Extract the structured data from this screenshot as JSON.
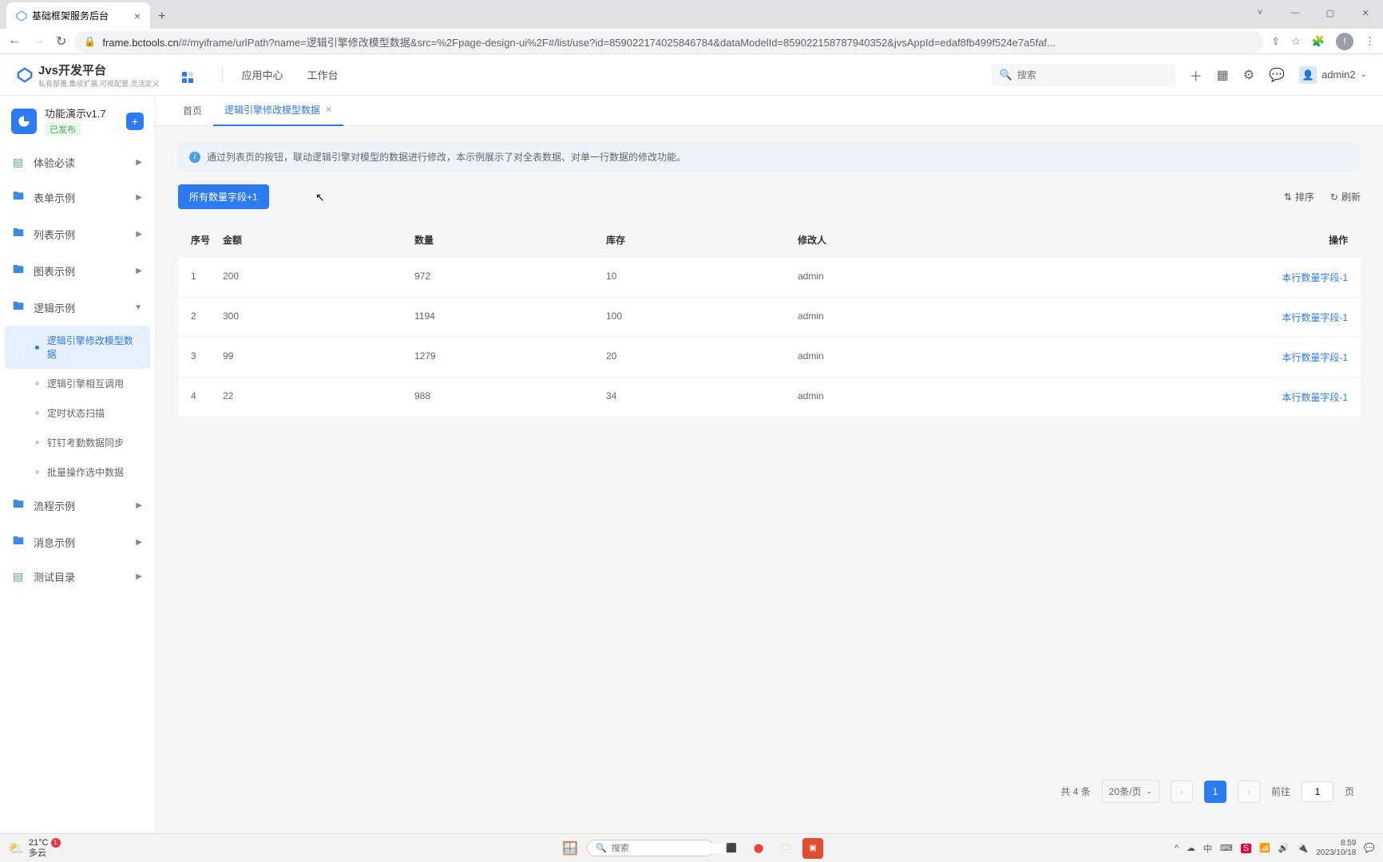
{
  "browser": {
    "tab_title": "基础框架服务后台",
    "url_prefix": "frame.bctools.cn",
    "url_rest": "/#/myiframe/urlPath?name=逻辑引擎修改模型数据&src=%2Fpage-design-ui%2F#/list/use?id=859022174025846784&dataModelId=859022158787940352&jvsAppId=edaf8fb499f524e7a5faf..."
  },
  "header": {
    "logo_title": "Jvs开发平台",
    "logo_sub": "私有部署.集成扩展.可视配置.灵活定义",
    "nav": [
      "应用中心",
      "工作台"
    ],
    "search_placeholder": "搜索",
    "user": "admin2"
  },
  "sidebar": {
    "project": {
      "title": "功能演示v1.7",
      "badge": "已发布"
    },
    "items": [
      {
        "icon": "doc",
        "label": "体验必读",
        "arrow": "right"
      },
      {
        "icon": "folder",
        "label": "表单示例",
        "arrow": "right"
      },
      {
        "icon": "folder",
        "label": "列表示例",
        "arrow": "right"
      },
      {
        "icon": "folder",
        "label": "图表示例",
        "arrow": "right"
      },
      {
        "icon": "folder",
        "label": "逻辑示例",
        "arrow": "down"
      },
      {
        "icon": "folder",
        "label": "流程示例",
        "arrow": "right"
      },
      {
        "icon": "folder",
        "label": "消息示例",
        "arrow": "right"
      },
      {
        "icon": "doc",
        "label": "测试目录",
        "arrow": "right"
      }
    ],
    "logic_sub": [
      {
        "label": "逻辑引擎修改模型数据",
        "active": true
      },
      {
        "label": "逻辑引擎相互调用",
        "active": false
      },
      {
        "label": "定时状态扫描",
        "active": false
      },
      {
        "label": "钉钉考勤数据同步",
        "active": false
      },
      {
        "label": "批量操作选中数据",
        "active": false
      }
    ]
  },
  "main_tabs": [
    {
      "label": "首页",
      "closable": false,
      "active": false
    },
    {
      "label": "逻辑引擎修改模型数据",
      "closable": true,
      "active": true
    }
  ],
  "banner": "通过列表页的按钮，联动逻辑引擎对模型的数据进行修改，本示例展示了对全表数据、对单一行数据的修改功能。",
  "toolbar": {
    "primary_btn": "所有数量字段+1",
    "sort": "排序",
    "refresh": "刷新"
  },
  "table": {
    "headers": {
      "idx": "序号",
      "amount": "金额",
      "qty": "数量",
      "stock": "库存",
      "modifier": "修改人",
      "op": "操作"
    },
    "op_link": "本行数量字段-1",
    "rows": [
      {
        "idx": "1",
        "amount": "200",
        "qty": "972",
        "stock": "10",
        "modifier": "admin"
      },
      {
        "idx": "2",
        "amount": "300",
        "qty": "1194",
        "stock": "100",
        "modifier": "admin"
      },
      {
        "idx": "3",
        "amount": "99",
        "qty": "1279",
        "stock": "20",
        "modifier": "admin"
      },
      {
        "idx": "4",
        "amount": "22",
        "qty": "988",
        "stock": "34",
        "modifier": "admin"
      }
    ]
  },
  "pagination": {
    "total": "共 4 条",
    "size": "20条/页",
    "current": "1",
    "goto_label": "前往",
    "goto_val": "1",
    "page_unit": "页"
  },
  "taskbar": {
    "weather_temp": "21°C",
    "weather_desc": "多云",
    "search_placeholder": "搜索",
    "time": "8:59",
    "date": "2023/10/18"
  }
}
